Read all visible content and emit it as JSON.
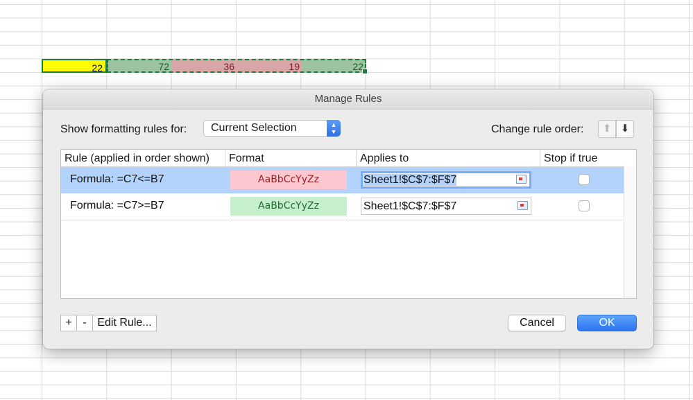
{
  "sheet": {
    "cells": [
      {
        "ref": "B7",
        "value": "22",
        "fill": "#ffff00"
      },
      {
        "ref": "C7",
        "value": "72",
        "fill": "#9dc3a3"
      },
      {
        "ref": "D7",
        "value": "36",
        "fill": "#d8a6a8"
      },
      {
        "ref": "E7",
        "value": "19",
        "fill": "#d8a6a8"
      },
      {
        "ref": "F7",
        "value": "22",
        "fill": "#9dc3a3"
      }
    ]
  },
  "dialog": {
    "title": "Manage Rules",
    "show_label": "Show formatting rules for:",
    "show_value": "Current Selection",
    "order_label": "Change rule order:",
    "columns": [
      "Rule (applied in order shown)",
      "Format",
      "Applies to",
      "Stop if true"
    ],
    "rules": [
      {
        "rule": "Formula: =C7<=B7",
        "format_preview": "AaBbCcYyZz",
        "applies_to": "Sheet1!$C$7:$F$7",
        "stop_if_true": false,
        "selected": true,
        "fill": "#fcc7ce",
        "font_color": "#9c1c22"
      },
      {
        "rule": "Formula: =C7>=B7",
        "format_preview": "AaBbCcYyZz",
        "applies_to": "Sheet1!$C$7:$F$7",
        "stop_if_true": false,
        "selected": false,
        "fill": "#c6efce",
        "font_color": "#1e6b2f"
      }
    ],
    "buttons": {
      "add": "+",
      "remove": "-",
      "edit": "Edit Rule...",
      "cancel": "Cancel",
      "ok": "OK"
    },
    "icons": {
      "order_up": "arrow-up-icon",
      "order_down": "arrow-down-icon",
      "ref": "range-select-icon"
    }
  }
}
